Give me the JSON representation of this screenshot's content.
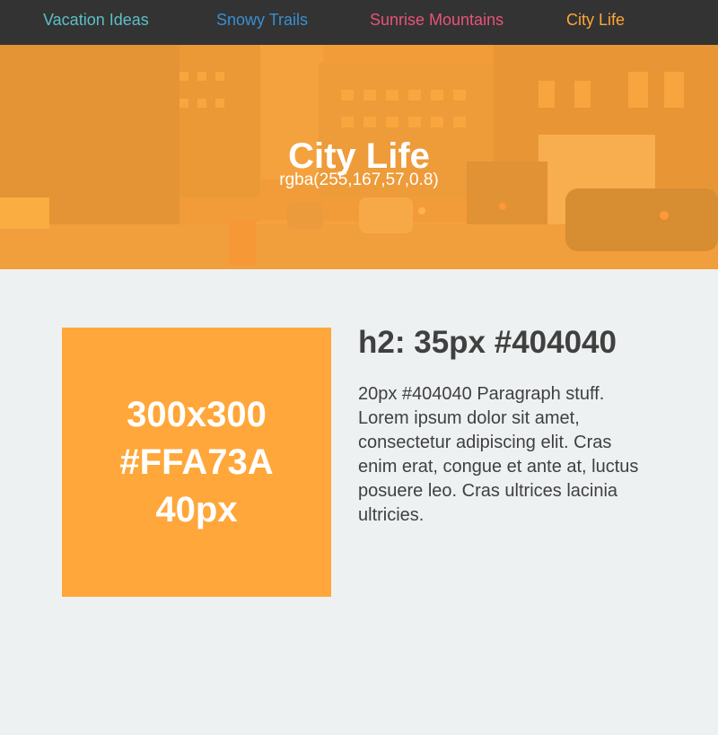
{
  "colors": {
    "nav_bg": "#333333",
    "page_bg": "#eef1f2",
    "hero_overlay": "rgba(255,167,57,0.8)",
    "box_bg": "#FFA73A",
    "text_dark": "#404040",
    "text_light": "#ffffff"
  },
  "nav": {
    "items": [
      {
        "label": "Vacation Ideas",
        "color": "#5bc0c7"
      },
      {
        "label": "Snowy Trails",
        "color": "#3a8fd1"
      },
      {
        "label": "Sunrise Mountains",
        "color": "#e8537a"
      },
      {
        "label": "City Life",
        "color": "#ffa73a"
      }
    ]
  },
  "hero": {
    "title": "City Life",
    "subtitle": "rgba(255,167,57,0.8)",
    "background": "city street photo"
  },
  "box": {
    "lines": [
      "300x300",
      "#FFA73A",
      "40px"
    ]
  },
  "content": {
    "heading": "h2: 35px #404040",
    "paragraph": "20px #404040 Paragraph stuff. Lorem ipsum dolor sit amet, consectetur adipiscing elit. Cras enim erat, congue et ante at, luctus posuere leo. Cras ultrices lacinia ultricies."
  }
}
